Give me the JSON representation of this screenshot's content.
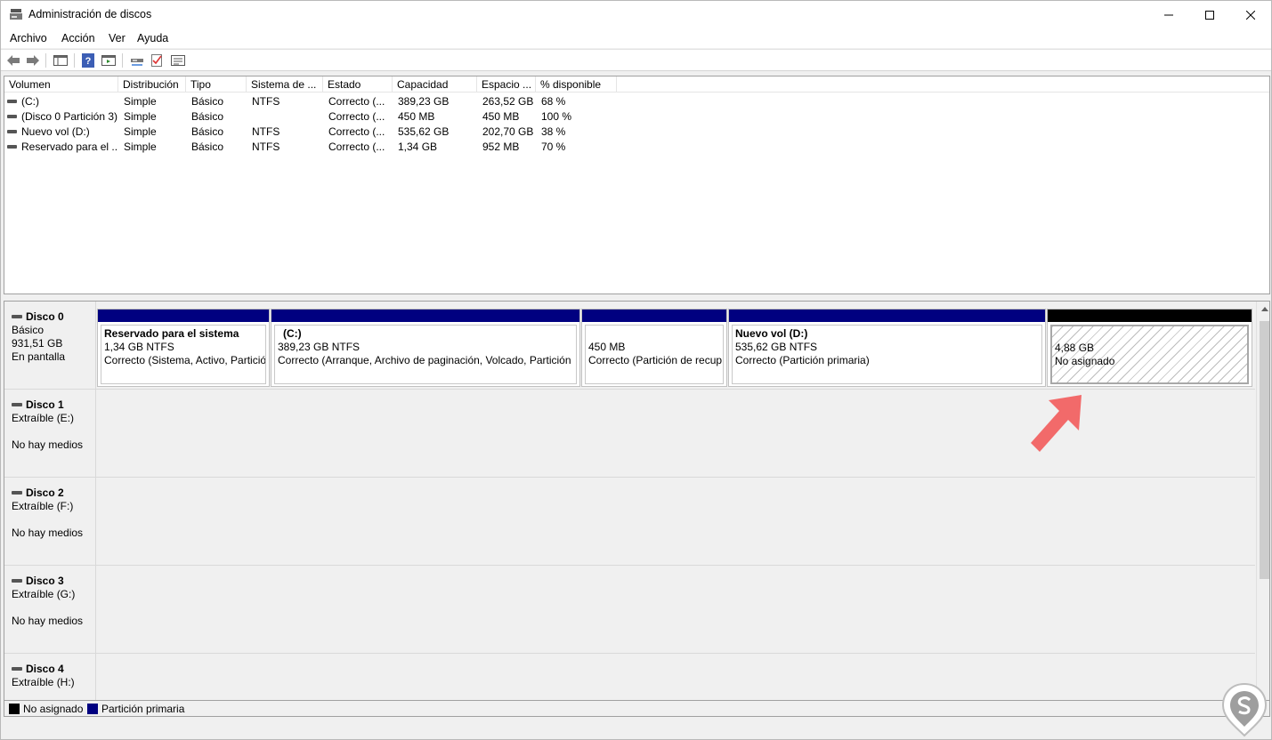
{
  "window": {
    "title": "Administración de discos"
  },
  "menu": [
    "Archivo",
    "Acción",
    "Ver",
    "Ayuda"
  ],
  "toolbar_icons": [
    "back-arrow-icon",
    "forward-arrow-icon",
    "console-tree-icon",
    "help-icon",
    "action-pane-icon",
    "connect-icon",
    "check-icon",
    "properties-icon"
  ],
  "list": {
    "columns": [
      "Volumen",
      "Distribución",
      "Tipo",
      "Sistema de ...",
      "Estado",
      "Capacidad",
      "Espacio ...",
      "% disponible"
    ],
    "rows": [
      {
        "volume": "(C:)",
        "layout": "Simple",
        "type": "Básico",
        "fs": "NTFS",
        "status": "Correcto (...",
        "capacity": "389,23 GB",
        "free": "263,52 GB",
        "pct": "68 %"
      },
      {
        "volume": "(Disco 0 Partición 3)",
        "layout": "Simple",
        "type": "Básico",
        "fs": "",
        "status": "Correcto (...",
        "capacity": "450 MB",
        "free": "450 MB",
        "pct": "100 %"
      },
      {
        "volume": "Nuevo vol (D:)",
        "layout": "Simple",
        "type": "Básico",
        "fs": "NTFS",
        "status": "Correcto (...",
        "capacity": "535,62 GB",
        "free": "202,70 GB",
        "pct": "38 %"
      },
      {
        "volume": "Reservado para el ...",
        "layout": "Simple",
        "type": "Básico",
        "fs": "NTFS",
        "status": "Correcto (...",
        "capacity": "1,34 GB",
        "free": "952 MB",
        "pct": "70 %"
      }
    ]
  },
  "disks": [
    {
      "name": "Disco 0",
      "line1": "Básico",
      "line2": "931,51 GB",
      "line3": "En pantalla",
      "partitions": [
        {
          "name": "Reservado para el sistema",
          "size": "1,34 GB NTFS",
          "status": "Correcto (Sistema, Activo, Partició"
        },
        {
          "name": "(C:)",
          "size": "389,23 GB NTFS",
          "status": "Correcto (Arranque, Archivo de paginación, Volcado, Partición"
        },
        {
          "name": "",
          "size": "450 MB",
          "status": "Correcto (Partición de recup"
        },
        {
          "name": "Nuevo vol  (D:)",
          "size": "535,62 GB NTFS",
          "status": "Correcto (Partición primaria)"
        },
        {
          "name": "",
          "size": "4,88 GB",
          "status": "No asignado"
        }
      ]
    },
    {
      "name": "Disco 1",
      "line1": "Extraíble (E:)",
      "line2": "No hay medios"
    },
    {
      "name": "Disco 2",
      "line1": "Extraíble (F:)",
      "line2": "No hay medios"
    },
    {
      "name": "Disco 3",
      "line1": "Extraíble (G:)",
      "line2": "No hay medios"
    },
    {
      "name": "Disco 4",
      "line1": "Extraíble (H:)"
    }
  ],
  "legend": [
    {
      "label": "No asignado",
      "color": "#000000"
    },
    {
      "label": "Partición primaria",
      "color": "#000080"
    }
  ],
  "colors": {
    "primary_partition": "#000080",
    "unallocated": "#000000",
    "annotation_arrow": "#f26a6a"
  }
}
